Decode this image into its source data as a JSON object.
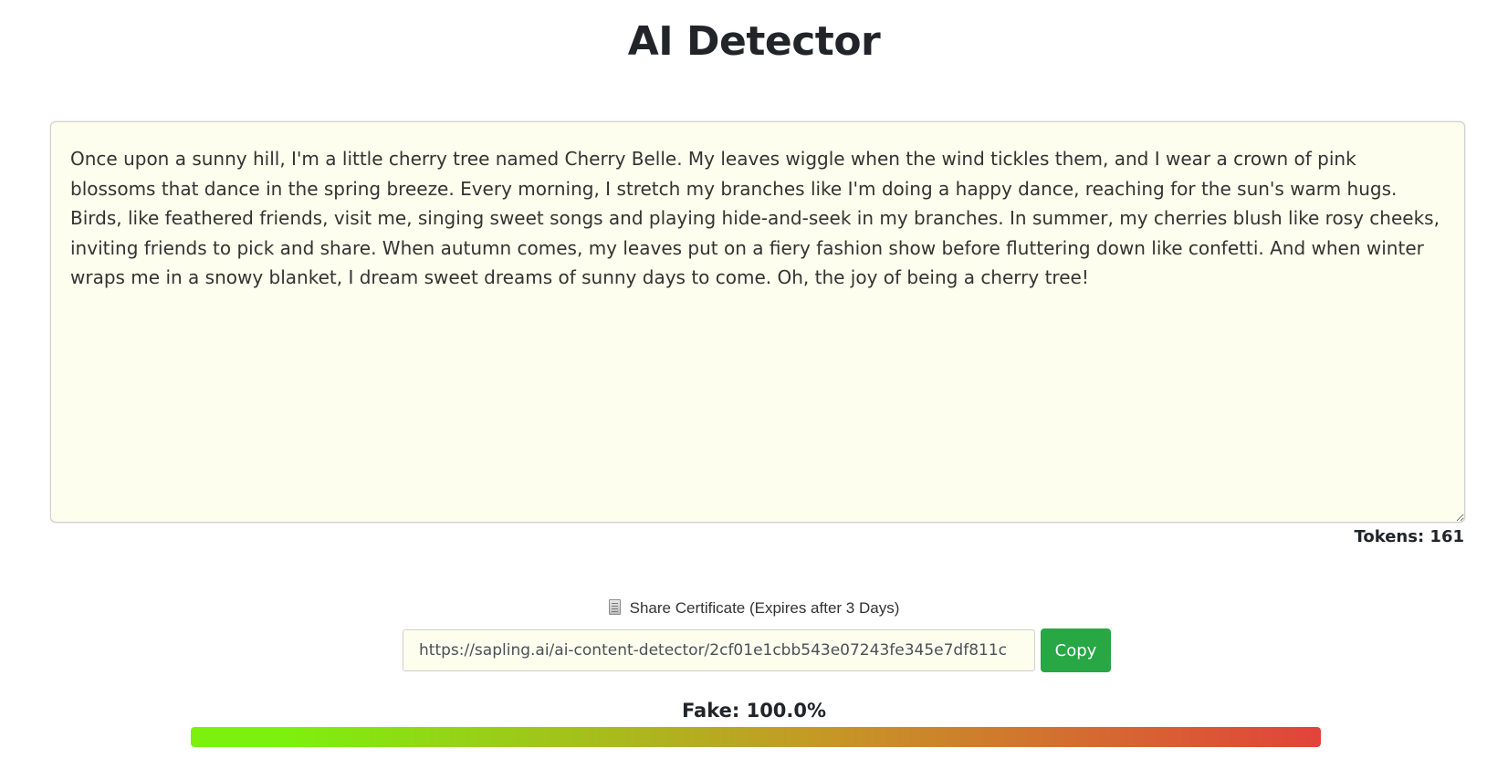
{
  "page": {
    "title": "AI Detector"
  },
  "editor": {
    "text": "Once upon a sunny hill, I'm a little cherry tree named Cherry Belle. My leaves wiggle when the wind tickles them, and I wear a crown of pink blossoms that dance in the spring breeze. Every morning, I stretch my branches like I'm doing a happy dance, reaching for the sun's warm hugs. Birds, like feathered friends, visit me, singing sweet songs and playing hide-and-seek in my branches. In summer, my cherries blush like rosy cheeks, inviting friends to pick and share. When autumn comes, my leaves put on a fiery fashion show before fluttering down like confetti. And when winter wraps me in a snowy blanket, I dream sweet dreams of sunny days to come. Oh, the joy of being a cherry tree!",
    "tokens_label": "Tokens: 161"
  },
  "share": {
    "icon": "document-icon",
    "label": "Share Certificate (Expires after 3 Days)",
    "url": "https://sapling.ai/ai-content-detector/2cf01e1cbb543e07243fe345e7df811c",
    "copy_label": "Copy"
  },
  "result": {
    "fake_label": "Fake: 100.0%",
    "fake_fraction": 1.0
  },
  "colors": {
    "editor_bg": "#fefeee",
    "copy_button": "#28a745",
    "meter_start": "#7cf10e",
    "meter_mid": "#c49a25",
    "meter_end": "#e2433a"
  }
}
